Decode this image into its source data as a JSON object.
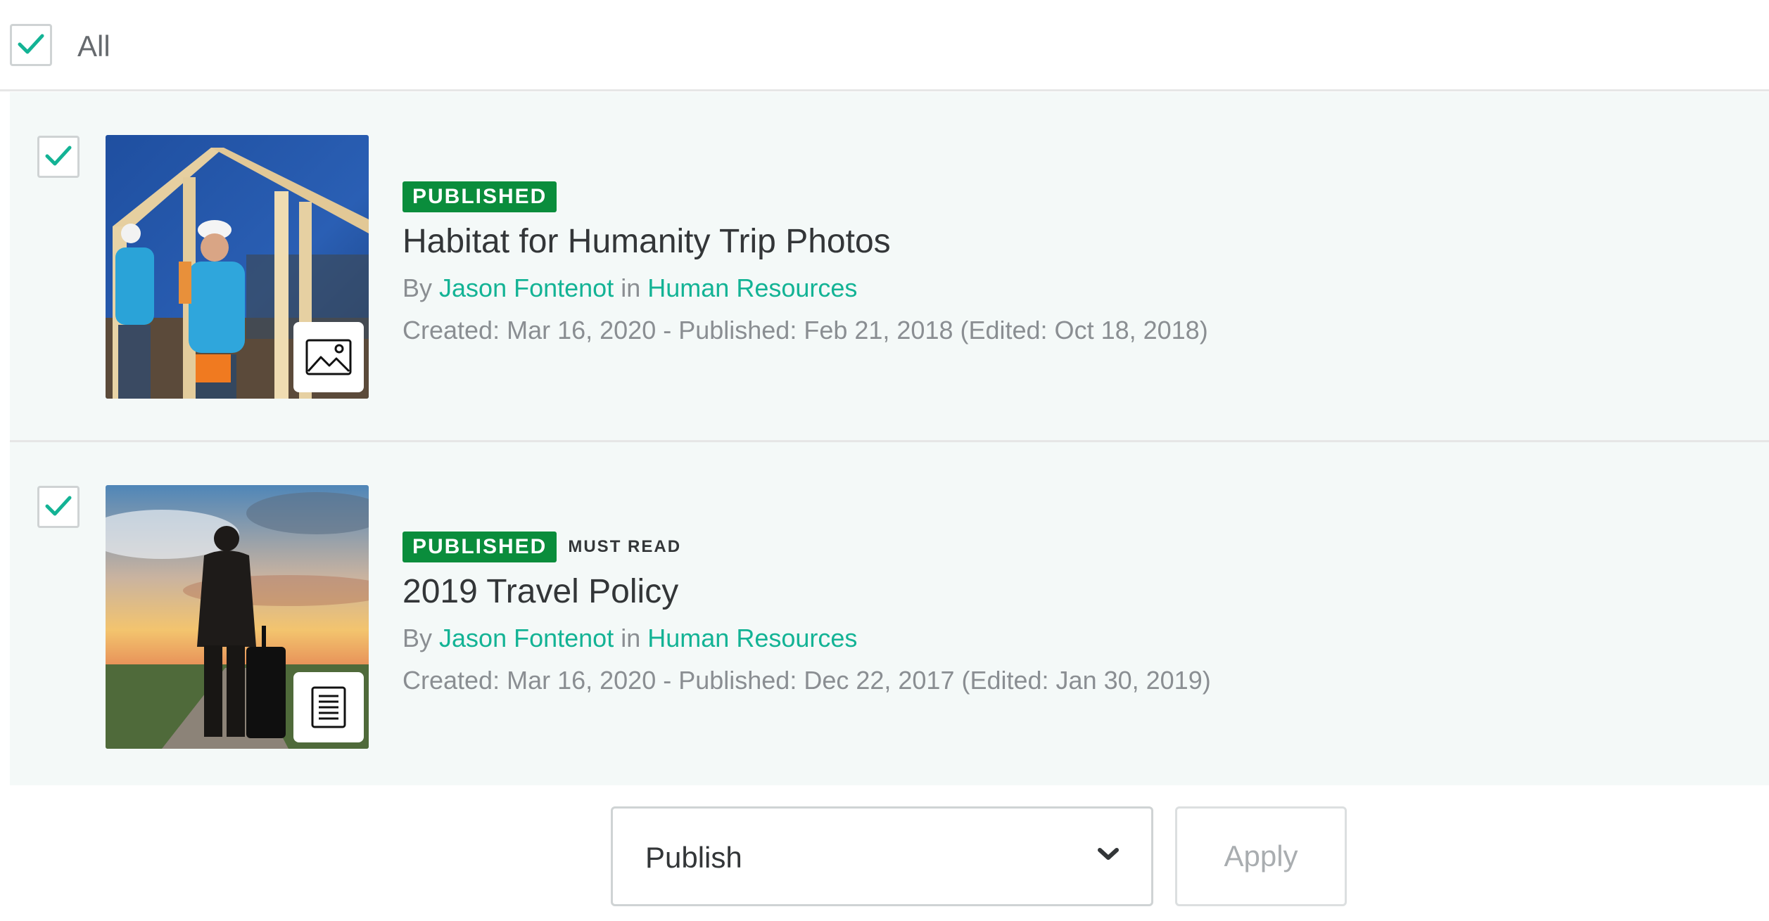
{
  "select_all": {
    "label": "All",
    "checked": true
  },
  "colors": {
    "published_badge": "#0a8d3c",
    "link": "#13b395",
    "checkmark": "#13b395",
    "row_background": "#f4f9f8"
  },
  "items": [
    {
      "checked": true,
      "status": "PUBLISHED",
      "tag": "",
      "title": "Habitat for Humanity Trip Photos",
      "by_prefix": "By",
      "author": "Jason Fontenot",
      "in_word": "in",
      "category": "Human Resources",
      "meta": "Created: Mar 16, 2020 - Published: Feb 21, 2018 (Edited: Oct 18, 2018)",
      "type_icon": "image-icon"
    },
    {
      "checked": true,
      "status": "PUBLISHED",
      "tag": "MUST READ",
      "title": "2019 Travel Policy",
      "by_prefix": "By",
      "author": "Jason Fontenot",
      "in_word": "in",
      "category": "Human Resources",
      "meta": "Created: Mar 16, 2020 - Published: Dec 22, 2017 (Edited: Jan 30, 2019)",
      "type_icon": "document-icon"
    }
  ],
  "bulk_action": {
    "selected": "Publish",
    "apply_label": "Apply",
    "chevron_icon": "chevron-down-icon"
  }
}
